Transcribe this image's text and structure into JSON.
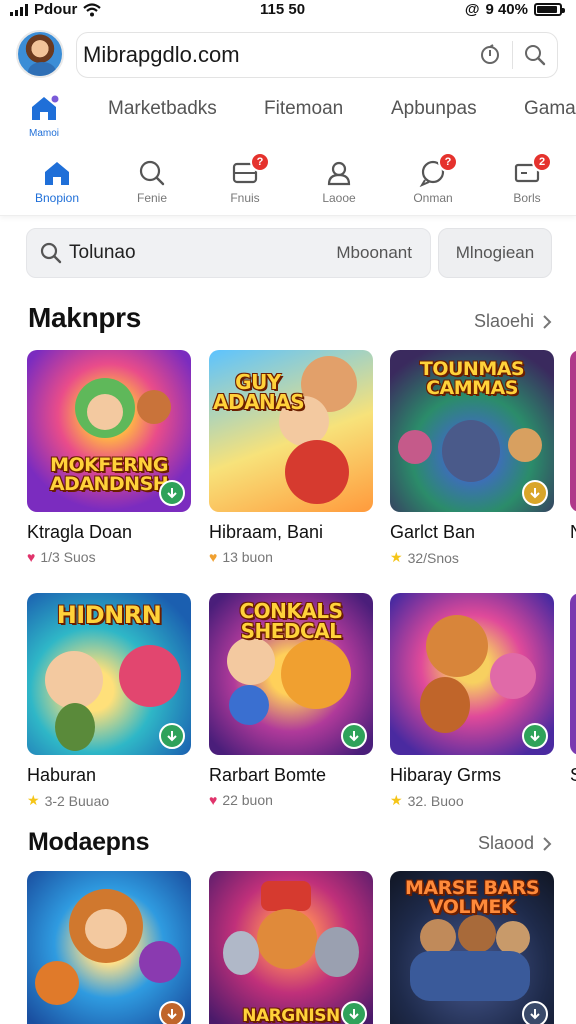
{
  "status": {
    "carrier": "Pdour",
    "time": "115 50",
    "battery_text": "9 40%",
    "battery_level": 0.9
  },
  "browser": {
    "url": "Mibrapgdlo.com"
  },
  "categories": {
    "home_label": "Mamoi",
    "items": [
      "Marketbadks",
      "Fitemoan",
      "Apbunpas",
      "Gamas"
    ]
  },
  "tabs": [
    {
      "label": "Bnopion",
      "icon": "home-icon",
      "active": true,
      "badge": ""
    },
    {
      "label": "Fenie",
      "icon": "search-icon",
      "active": false,
      "badge": ""
    },
    {
      "label": "Fnuis",
      "icon": "inbox-icon",
      "active": false,
      "badge": "?"
    },
    {
      "label": "Laooe",
      "icon": "user-icon",
      "active": false,
      "badge": ""
    },
    {
      "label": "Onman",
      "icon": "chat-icon",
      "active": false,
      "badge": "?"
    },
    {
      "label": "Borls",
      "icon": "cart-icon",
      "active": false,
      "badge": "2"
    }
  ],
  "search": {
    "query": "Tolunao",
    "scope": "Mboonant",
    "button": "Mlnogiean"
  },
  "sections": [
    {
      "title": "Maknprs",
      "link": "Slaoehi",
      "rows": [
        [
          {
            "name": "Ktragla Doan",
            "rating_icon": "heart-icon",
            "rating_color": "#e0336b",
            "meta": "1/3 Suos",
            "art_title": "MOKFERNG ADANDNSH"
          },
          {
            "name": "Hibraam, Bani",
            "rating_icon": "heart-icon",
            "rating_color": "#f0a030",
            "meta": "13 buon",
            "art_title": "GUY ADANAS"
          },
          {
            "name": "Garlct Ban",
            "rating_icon": "star-icon",
            "rating_color": "#f5c518",
            "meta": "32/Snos",
            "art_title": "TOUNMAS CAMMAS"
          },
          {
            "name": "N",
            "rating_icon": "star-icon",
            "rating_color": "#f5c518",
            "meta": "",
            "art_title": ""
          }
        ],
        [
          {
            "name": "Haburan",
            "rating_icon": "star-icon",
            "rating_color": "#f5c518",
            "meta": "3-2 Buuao",
            "art_title": "HIDNRN"
          },
          {
            "name": "Rarbart Bomte",
            "rating_icon": "heart-icon",
            "rating_color": "#e0336b",
            "meta": "22 buon",
            "art_title": "CONKALS SHEDCAL"
          },
          {
            "name": "Hibaray Grms",
            "rating_icon": "star-icon",
            "rating_color": "#f5c518",
            "meta": "32. Buoo",
            "art_title": ""
          },
          {
            "name": "S",
            "rating_icon": "star-icon",
            "rating_color": "#f5c518",
            "meta": "",
            "art_title": ""
          }
        ]
      ]
    },
    {
      "title": "Modaepns",
      "link": "Slaood",
      "rows": [
        [
          {
            "name": "",
            "rating_icon": "",
            "rating_color": "",
            "meta": "",
            "art_title": ""
          },
          {
            "name": "",
            "rating_icon": "",
            "rating_color": "",
            "meta": "",
            "art_title": "NARGNISN"
          },
          {
            "name": "",
            "rating_icon": "",
            "rating_color": "",
            "meta": "",
            "art_title": "MARSE BARS VOLMEK"
          }
        ]
      ]
    }
  ],
  "colors": {
    "accent": "#1f6fd8",
    "badge": "#e5322d",
    "download": "#2fa25a"
  }
}
